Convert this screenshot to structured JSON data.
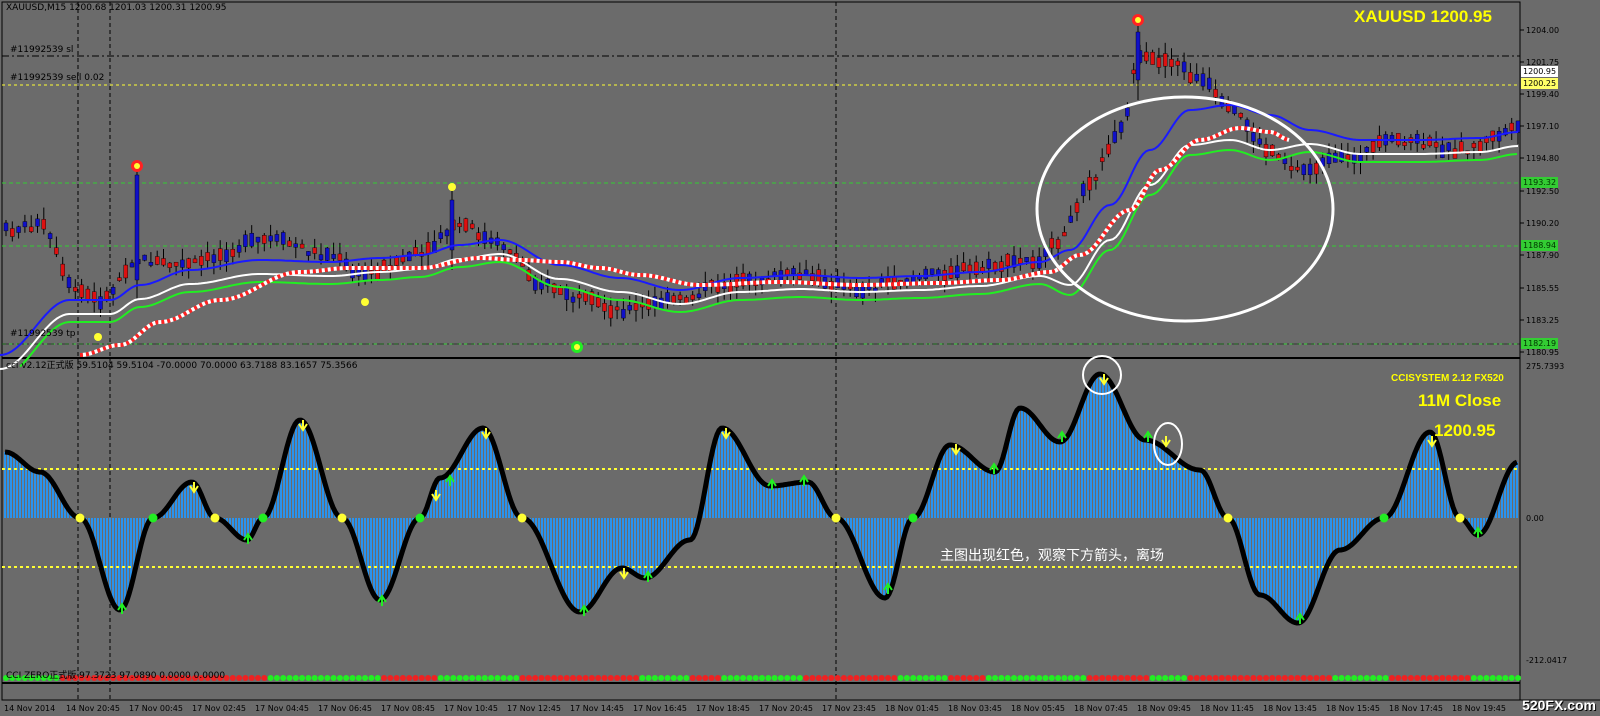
{
  "main": {
    "header": "XAUUSD,M15  1200.68 1201.03 1200.31 1200.95",
    "symbol_price": "XAUUSD  1200.95",
    "orders": {
      "sl": "#11992539 sl",
      "sell": "#11992539 sell 0.02",
      "tp": "#11992539 tp"
    },
    "price_ticks": [
      "1204.00",
      "1201.75",
      "1199.40",
      "1197.10",
      "1194.80",
      "1192.50",
      "1190.20",
      "1187.90",
      "1185.55",
      "1183.25",
      "1180.95"
    ],
    "price_tags": [
      {
        "text": "1200.95",
        "bg": "#ffffff",
        "color": "#000000"
      },
      {
        "text": "1200.25",
        "bg": "#ffff66",
        "color": "#000000"
      },
      {
        "text": "1193.32",
        "bg": "#33cc33",
        "color": "#003300"
      },
      {
        "text": "1188.94",
        "bg": "#33cc33",
        "color": "#003300"
      },
      {
        "text": "1182.19",
        "bg": "#33cc33",
        "color": "#003300"
      }
    ]
  },
  "cci": {
    "header": "cci v2.12正式版 59.5104 59.5104 -70.0000 70.0000 63.7188 83.1657 75.3566",
    "system": "CCISYSTEM 2.12 FX520",
    "close_label": "11M Close",
    "close_value": "1200.95",
    "ticks": [
      "275.7393",
      "0.00",
      "-212.0417"
    ],
    "annotation": "主图出现红色，观察下方箭头，离场"
  },
  "zero_bar": {
    "header": "CCI ZERO正式版 97.3723 97.0890 0.0000 0.0000"
  },
  "time_axis": [
    "14 Nov 2014",
    "14 Nov 20:45",
    "17 Nov 00:45",
    "17 Nov 02:45",
    "17 Nov 04:45",
    "17 Nov 06:45",
    "17 Nov 08:45",
    "17 Nov 10:45",
    "17 Nov 12:45",
    "17 Nov 14:45",
    "17 Nov 16:45",
    "17 Nov 18:45",
    "17 Nov 20:45",
    "17 Nov 23:45",
    "18 Nov 01:45",
    "18 Nov 03:45",
    "18 Nov 05:45",
    "18 Nov 07:45",
    "18 Nov 09:45",
    "18 Nov 11:45",
    "18 Nov 13:45",
    "18 Nov 15:45",
    "18 Nov 17:45",
    "18 Nov 19:45"
  ],
  "watermark": "520FX.com",
  "colors": {
    "background": "#6b6b6b",
    "bull": "#1010c8",
    "bear": "#dd1111",
    "ma_blue": "#1a1aff",
    "ma_white": "#ffffff",
    "ma_green": "#22ee22",
    "cci_fill": "#2a93ee",
    "cci_line": "#000000",
    "levels": "#ffff33"
  }
}
